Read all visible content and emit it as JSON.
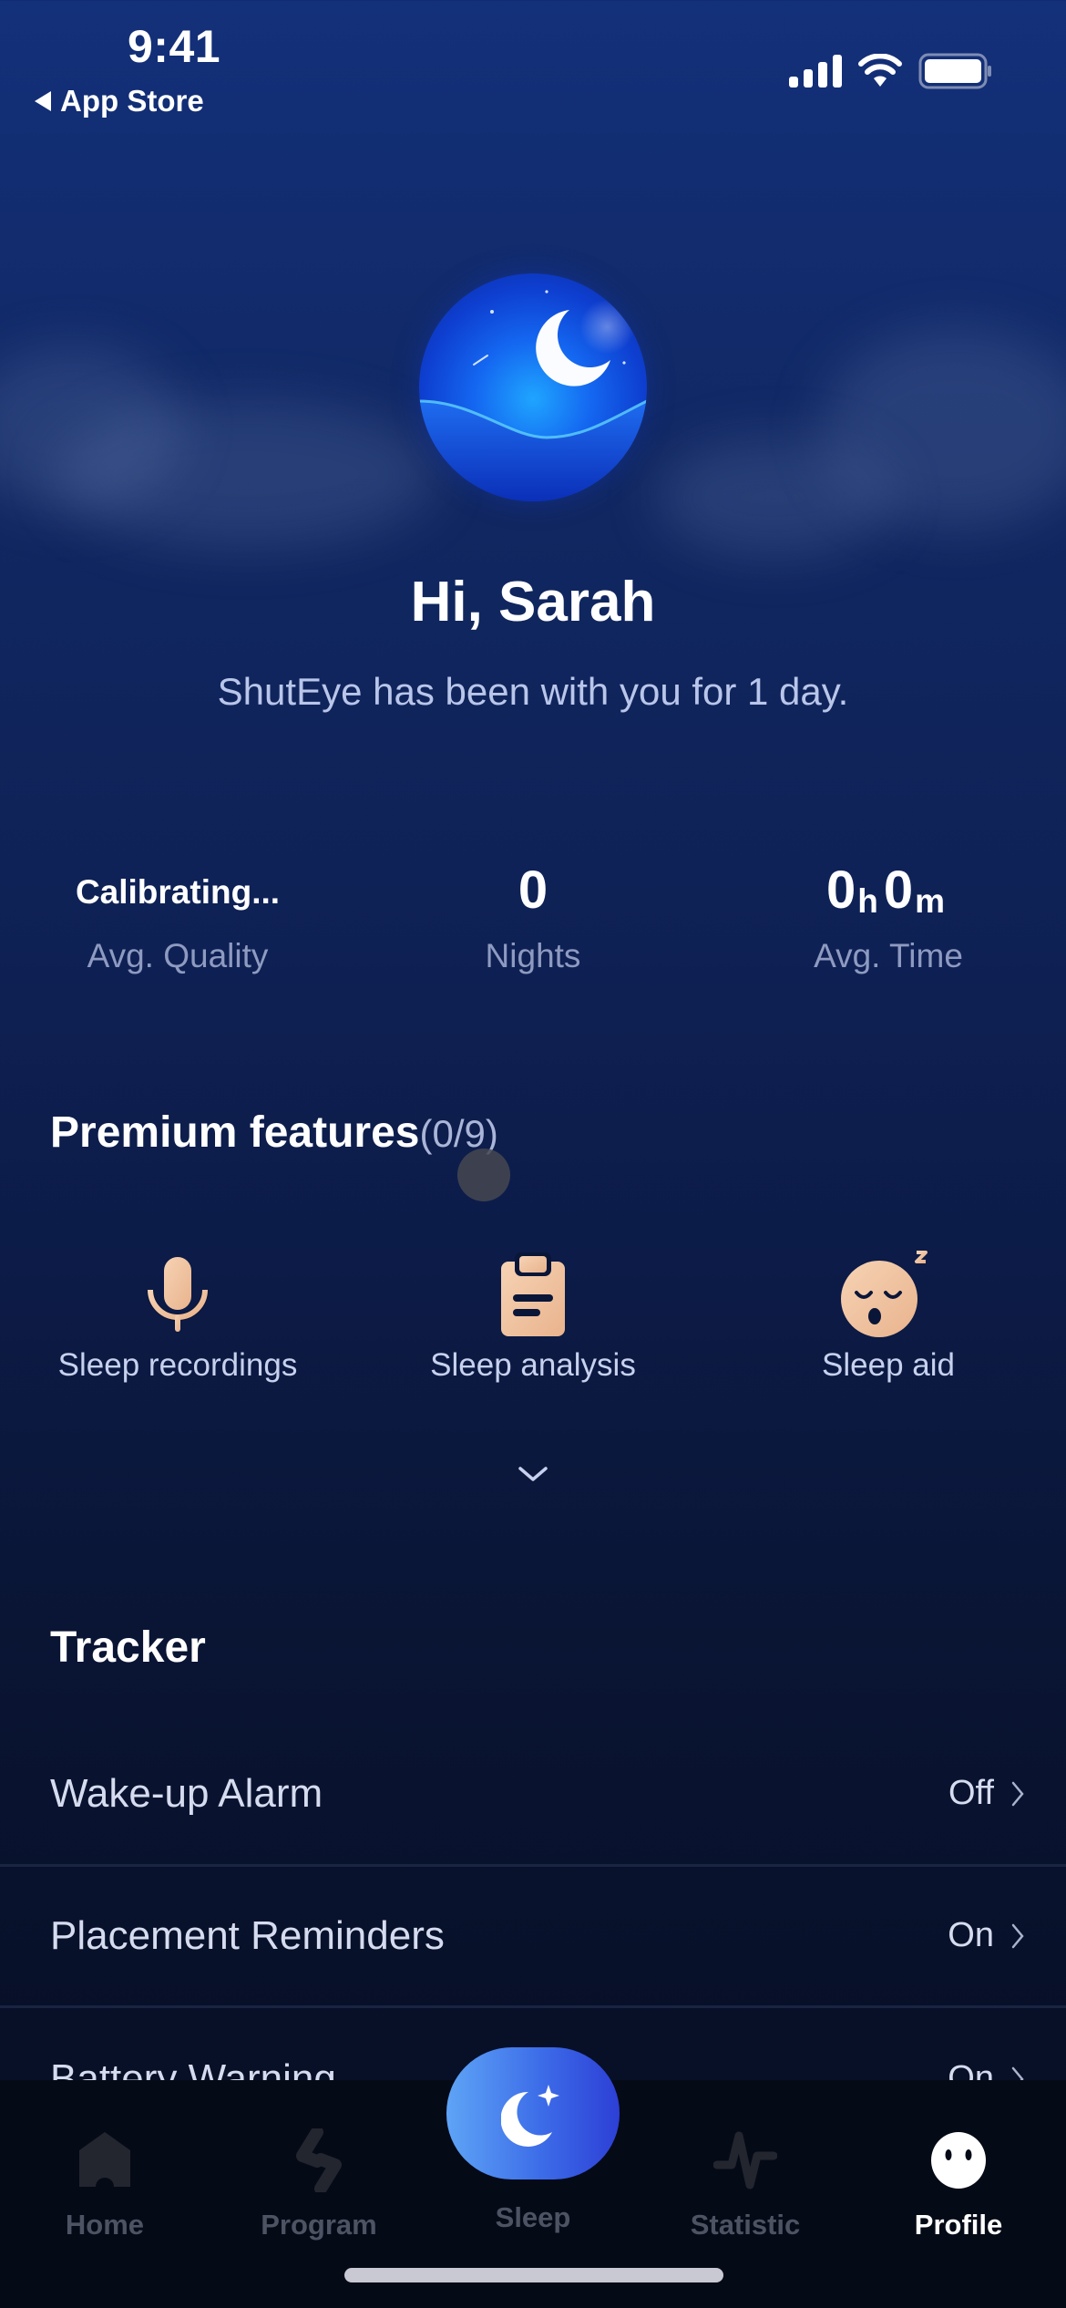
{
  "status_bar": {
    "time": "9:41",
    "back_label": "App Store",
    "icons": [
      "cellular-signal-icon",
      "wifi-icon",
      "battery-icon"
    ]
  },
  "profile": {
    "avatar_icon": "moon-night-avatar",
    "greeting": "Hi, Sarah",
    "subtitle": "ShutEye has been with you for 1 day."
  },
  "stats": [
    {
      "value": "Calibrating...",
      "label": "Avg. Quality"
    },
    {
      "value": "0",
      "label": "Nights"
    },
    {
      "hours": "0",
      "hours_unit": "h",
      "minutes": "0",
      "minutes_unit": "m",
      "label": "Avg. Time"
    }
  ],
  "premium": {
    "title": "Premium features",
    "count": "(0/9)",
    "features": [
      {
        "label": "Sleep recordings",
        "icon": "microphone-icon"
      },
      {
        "label": "Sleep analysis",
        "icon": "clipboard-icon"
      },
      {
        "label": "Sleep aid",
        "icon": "sleepy-face-icon"
      }
    ],
    "expand_icon": "chevron-down-icon"
  },
  "tracker": {
    "title": "Tracker",
    "rows": [
      {
        "label": "Wake-up Alarm",
        "value": "Off"
      },
      {
        "label": "Placement Reminders",
        "value": "On"
      },
      {
        "label": "Battery Warning",
        "value": "On"
      }
    ]
  },
  "tabbar": {
    "tabs": [
      {
        "label": "Home",
        "icon": "home-icon",
        "active": false
      },
      {
        "label": "Program",
        "icon": "program-icon",
        "active": false
      },
      {
        "label": "Sleep",
        "icon": "moon-star-icon",
        "active": false
      },
      {
        "label": "Statistic",
        "icon": "pulse-icon",
        "active": false
      },
      {
        "label": "Profile",
        "icon": "ghost-face-icon",
        "active": true
      }
    ]
  },
  "colors": {
    "accent_peach": "#f2c4a0",
    "sleep_button_start": "#5ea4f6",
    "sleep_button_end": "#2d3fd6",
    "inactive_tab": "#4d5363"
  }
}
